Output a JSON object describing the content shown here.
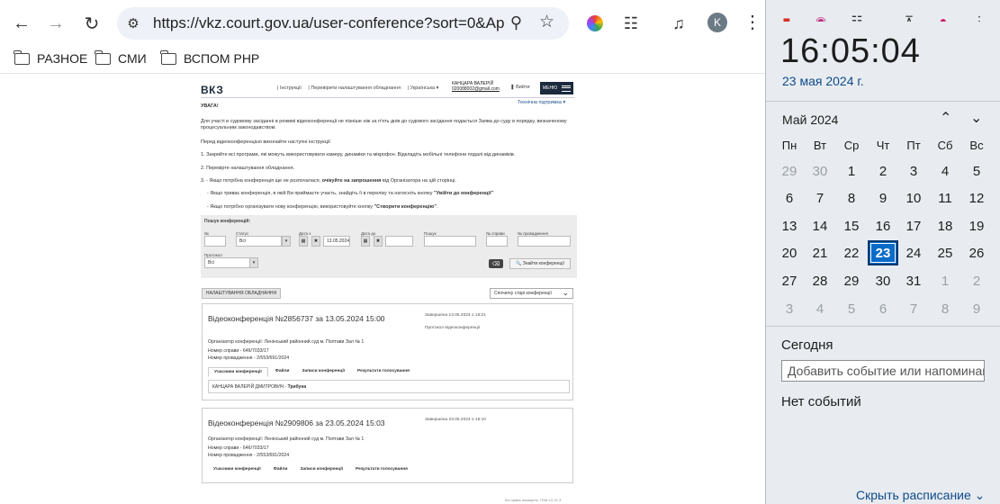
{
  "browser": {
    "url": "https://vkz.court.gov.ua/user-conference?sort=0&Appo...",
    "profile_initial": "K",
    "bookmarks": [
      "РАЗНОЕ",
      "СМИ",
      "ВСПОМ РНР"
    ]
  },
  "site": {
    "logo": "ВКЗ",
    "nav": [
      "| Інструкції",
      "| Перевірити налаштування обладнання",
      "| Українська ▾"
    ],
    "user_name": "КАНЦАРА ВАЛЕРІЙ",
    "user_email": "020088002@gmail.com",
    "logout": "Вийти",
    "menu": "МЕНЮ",
    "support": "Технічна підтримка ▾",
    "warning_title": "УВАГА!",
    "intro_1": "Для участі в судовому засіданні в режимі відеоконференції не пізніше ніж за п'ять днів до судового засідання подається Заява до суду в порядку, визначеному процесуальним законодавством.",
    "intro_2": "Перед відеоконференцією виконайте наступні інструкції:",
    "step_1": "1. Закрийте всі програми, які можуть використовувати камеру, динаміки та мікрофон. Відкладіть мобільні телефони подалі від динаміків.",
    "step_2": "2. Перевірте налаштування обладнання.",
    "step_3_a": "3.  - Якщо потрібна конференція ще не розпочалася, ",
    "step_3_b": "очікуйте на запрошення",
    "step_3_c": " від Організатора на цій сторінці.",
    "step_3_d_a": "- Якщо триває конференція, в якій Ви приймаєте участь, знайдіть її в переліку та натисніть кнопку ",
    "step_3_d_b": "\"Увійти до конференції\"",
    "step_3_e_a": "- Якщо потрібно організувати нову конференцію, використовуйте кнопку ",
    "step_3_e_b": "\"Створити конференцію\"",
    "step_3_e_c": "."
  },
  "search": {
    "title": "Пошук конференцій:",
    "no_label": "№",
    "status_label": "Статус",
    "status_value": "Всі",
    "date_from_label": "Дата з",
    "date_from_value": "13.05.2024",
    "date_to_label": "Дата до",
    "search_label": "Пошук",
    "case_label": "№ справи",
    "proceeding_label": "№ провадження",
    "protocol_label": "Протокол",
    "protocol_value": "Всі",
    "find_button": "🔍 Знайти конференції",
    "settings_button": "НАЛАШТУВАННЯ ОБЛАДНАННЯ",
    "sort_value": "Спочатку старі конференції"
  },
  "conferences": [
    {
      "title": "Відеоконференція №2856737 за 13.05.2024 15:00",
      "status": "Завершена 13.05.2024 о 15:21",
      "protocol": "Протокол відеоконференції",
      "organizer": "Організатор конференції: Ленінський районний суд м. Полтави Зал № 1",
      "case": "Номер справи - 646/7033/17",
      "proceeding": "Номер провадження - 2/553/691/2024",
      "tabs": [
        "Учасники конференції",
        "Файли",
        "Записи конференції",
        "Результати голосування"
      ],
      "participant_name": "КАНЦАРА ВАЛЕРІЙ ДМИТРОВИЧ - ",
      "participant_role": "Трибуна"
    },
    {
      "title": "Відеоконференція №2909806 за 23.05.2024 15:03",
      "status": "Завершена 23.05.2024 о 15:10",
      "organizer": "Організатор конференції: Ленінський районний суд м. Полтави Зал № 1",
      "case": "Номер справи - 646/7033/17",
      "proceeding": "Номер провадження - 2/553/691/2024",
      "tabs": [
        "Учасники конференції",
        "Файли",
        "Записи конференції",
        "Результати голосування"
      ]
    }
  ],
  "footer": "Всі права захищено. ГБМ v.2.41.3",
  "calendar": {
    "time": "16:05:04",
    "date": "23 мая 2024 г.",
    "month": "Май 2024",
    "weekdays": [
      "Пн",
      "Вт",
      "Ср",
      "Чт",
      "Пт",
      "Сб",
      "Вс"
    ],
    "weeks": [
      [
        "29",
        "30",
        "1",
        "2",
        "3",
        "4",
        "5"
      ],
      [
        "6",
        "7",
        "8",
        "9",
        "10",
        "11",
        "12"
      ],
      [
        "13",
        "14",
        "15",
        "16",
        "17",
        "18",
        "19"
      ],
      [
        "20",
        "21",
        "22",
        "23",
        "24",
        "25",
        "26"
      ],
      [
        "27",
        "28",
        "29",
        "30",
        "31",
        "1",
        "2"
      ],
      [
        "3",
        "4",
        "5",
        "6",
        "7",
        "8",
        "9"
      ]
    ],
    "selected_day": "23",
    "today_label": "Сегодня",
    "event_placeholder": "Добавить событие или напоминание",
    "no_events": "Нет событий",
    "schedule_link": "Скрыть расписание",
    "accent_color": "#0a6bc8"
  }
}
